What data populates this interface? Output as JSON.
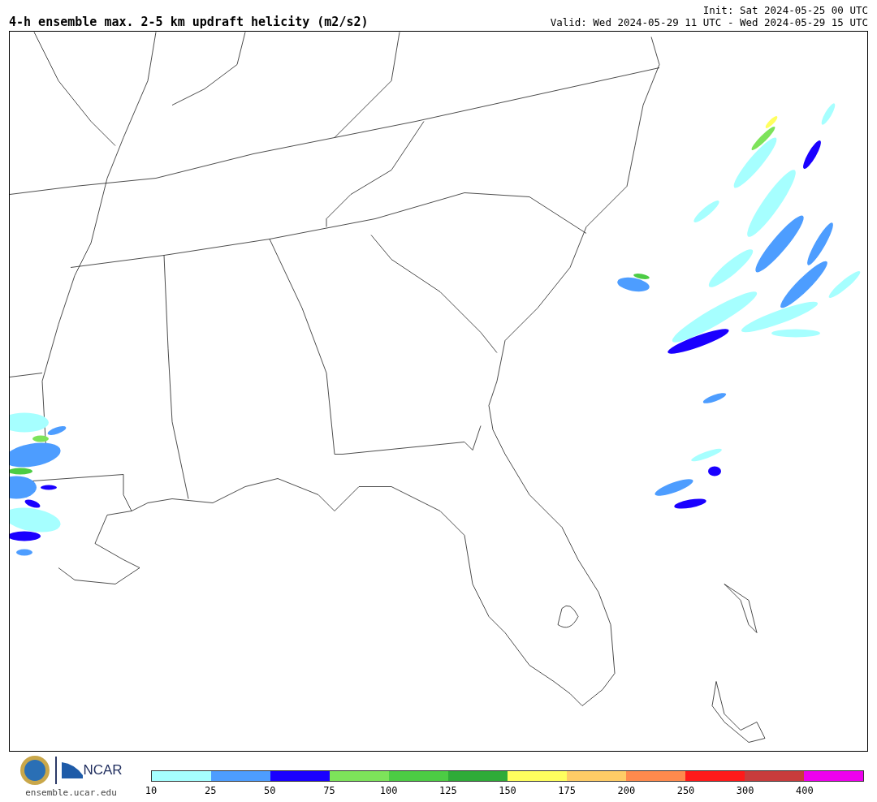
{
  "title": "4-h ensemble max. 2-5 km updraft helicity (m2/s2)",
  "init": "Init: Sat 2024-05-25 00 UTC",
  "valid": "Valid: Wed 2024-05-29 11 UTC - Wed 2024-05-29 15 UTC",
  "footer": {
    "logo_text": "NCAR",
    "url": "ensemble.ucar.edu"
  },
  "legend": {
    "bins": [
      {
        "color": "#a6ffff"
      },
      {
        "color": "#4d9dff"
      },
      {
        "color": "#1a00ff"
      },
      {
        "color": "#7de35a"
      },
      {
        "color": "#4ccc44"
      },
      {
        "color": "#2eab38"
      },
      {
        "color": "#ffff5e"
      },
      {
        "color": "#ffcc66"
      },
      {
        "color": "#ff8a4d"
      },
      {
        "color": "#ff1a1a"
      },
      {
        "color": "#c83c3c"
      },
      {
        "color": "#ee00ee"
      }
    ],
    "ticks": [
      "10",
      "25",
      "50",
      "75",
      "100",
      "125",
      "150",
      "175",
      "200",
      "250",
      "300",
      "400"
    ]
  }
}
